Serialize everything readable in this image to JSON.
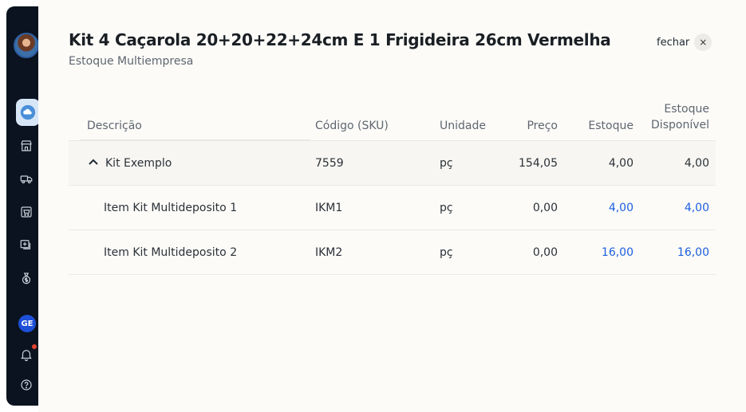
{
  "sidebar": {
    "badge_text": "GE",
    "icons": [
      "cloud-icon",
      "store-icon",
      "delivery-truck-icon",
      "cart-icon",
      "add-product-icon",
      "money-bag-icon",
      "bell-icon",
      "help-icon"
    ]
  },
  "header": {
    "title": "Kit 4 Caçarola 20+20+22+24cm E 1 Frigideira 26cm Vermelha",
    "subtitle": "Estoque Multiempresa",
    "close_label": "fechar",
    "close_icon": "×"
  },
  "table": {
    "columns": {
      "descricao": "Descrição",
      "codigo": "Código (SKU)",
      "unidade": "Unidade",
      "preco": "Preço",
      "estoque": "Estoque",
      "disponivel_line1": "Estoque",
      "disponivel_line2": "Disponível"
    },
    "rows": [
      {
        "descricao": "Kit Exemplo",
        "codigo": "7559",
        "unidade": "pç",
        "preco": "154,05",
        "estoque": "4,00",
        "disponivel": "4,00"
      },
      {
        "descricao": "Item Kit Multideposito 1",
        "codigo": "IKM1",
        "unidade": "pç",
        "preco": "0,00",
        "estoque": "4,00",
        "disponivel": "4,00"
      },
      {
        "descricao": "Item Kit Multideposito 2",
        "codigo": "IKM2",
        "unidade": "pç",
        "preco": "0,00",
        "estoque": "16,00",
        "disponivel": "16,00"
      }
    ]
  },
  "colors": {
    "link_blue": "#1d5fe0",
    "sidebar_bg": "#0b1320",
    "badge_blue": "#1e4fd8"
  }
}
